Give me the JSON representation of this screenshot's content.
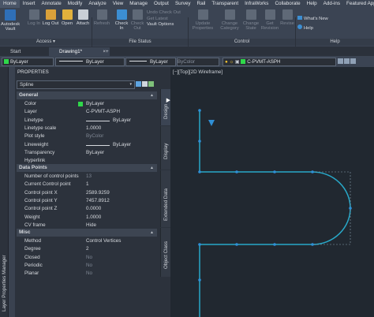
{
  "menu": {
    "tabs": [
      "Home",
      "Insert",
      "Annotate",
      "Modify",
      "Analyze",
      "View",
      "Manage",
      "Output",
      "Survey",
      "Rail",
      "Transparent",
      "InfraWorks",
      "Collaborate",
      "Help",
      "Add-ins",
      "Featured App"
    ]
  },
  "ribbon": {
    "autodesk_vault": "Autodesk\nVault",
    "log_in": "Log In",
    "log_out": "Log Out",
    "open": "Open",
    "attach": "Attach",
    "refresh": "Refresh",
    "check_in": "Check\nIn",
    "check_out": "Check\nOut",
    "undo_check_out": "Undo Check Out",
    "get_latest": "Get Latest",
    "vault_options": "Vault Options",
    "update_properties": "Update\nProperties",
    "change_category": "Change\nCategory",
    "change_state": "Change\nState",
    "get_revision": "Get\nRevision",
    "revise": "Revise",
    "whats_new": "What's New",
    "help": "Help",
    "panels": {
      "access": "Access ▾",
      "file_status": "File Status",
      "control": "Control",
      "help": "Help"
    }
  },
  "doc_tabs": {
    "start": "Start",
    "drawing": "Drawing1*",
    "add": "+"
  },
  "property_bar": {
    "layer": "ByLayer",
    "linetype": "ByLayer",
    "lineweight": "ByLayer",
    "color": "ByColor",
    "current_layer": "C-PVMT-ASPH"
  },
  "palette": {
    "title": "PROPERTIES",
    "side_label": "Layer Properties Manager",
    "selection": "Spline",
    "tabs": [
      "Design",
      "Display",
      "Extended Data",
      "Object Class"
    ],
    "general": {
      "header": "General",
      "rows": [
        {
          "k": "Color",
          "v": "ByLayer"
        },
        {
          "k": "Layer",
          "v": "C-PVMT-ASPH"
        },
        {
          "k": "Linetype",
          "v": "ByLayer"
        },
        {
          "k": "Linetype scale",
          "v": "1.0000"
        },
        {
          "k": "Plot style",
          "v": "ByColor"
        },
        {
          "k": "Lineweight",
          "v": "ByLayer"
        },
        {
          "k": "Transparency",
          "v": "ByLayer"
        },
        {
          "k": "Hyperlink",
          "v": ""
        }
      ]
    },
    "data_points": {
      "header": "Data Points",
      "rows": [
        {
          "k": "Number of control points",
          "v": "13"
        },
        {
          "k": "Current Control point",
          "v": "1"
        },
        {
          "k": "Control point X",
          "v": "2589.9259"
        },
        {
          "k": "Control point Y",
          "v": "7457.8912"
        },
        {
          "k": "Control point Z",
          "v": "0.0000"
        },
        {
          "k": "Weight",
          "v": "1.0000"
        },
        {
          "k": "CV frame",
          "v": "Hide"
        }
      ]
    },
    "misc": {
      "header": "Misc",
      "rows": [
        {
          "k": "Method",
          "v": "Control Vertices"
        },
        {
          "k": "Degree",
          "v": "2"
        },
        {
          "k": "Closed",
          "v": "No"
        },
        {
          "k": "Periodic",
          "v": "No"
        },
        {
          "k": "Planar",
          "v": "No"
        }
      ]
    }
  },
  "viewport": {
    "label": "[−][Top][2D Wireframe]"
  },
  "colors": {
    "accent": "#2f8fd6",
    "green": "#2fd84a",
    "spline": "#28a8c8"
  }
}
